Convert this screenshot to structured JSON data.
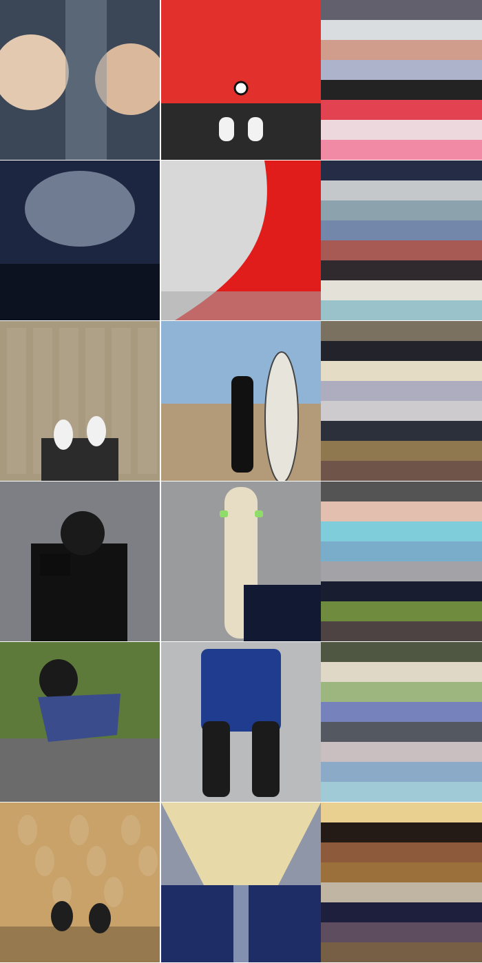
{
  "rows": [
    {
      "photos": [
        {
          "subject": "two-men-selfie-looking-up",
          "palette_hint": [
            "#6d7a86",
            "#e3c9b0"
          ]
        },
        {
          "subject": "red-bmw-hood-and-sneakers",
          "palette_hint": [
            "#e2302c",
            "#2a2a2a"
          ]
        }
      ],
      "swatches": [
        "#62606c",
        "#d9dde0",
        "#d09c8b",
        "#acb3cb",
        "#232323",
        "#e34350",
        "#ecd8dd",
        "#f08aa5"
      ]
    },
    {
      "photos": [
        {
          "subject": "concert-crowd-stage-lights",
          "palette_hint": [
            "#1c2640",
            "#b7c3d4"
          ]
        },
        {
          "subject": "gallery-red-curved-wall",
          "palette_hint": [
            "#e11d1b",
            "#d8d8d8"
          ]
        }
      ],
      "swatches": [
        "#252d46",
        "#c4c8cb",
        "#8ca3ae",
        "#7387ab",
        "#a75a54",
        "#302a2e",
        "#e4e2d8",
        "#9ac2cb"
      ]
    },
    {
      "photos": [
        {
          "subject": "feet-on-patterned-floor",
          "palette_hint": [
            "#a89a7e",
            "#2b2b2b"
          ]
        },
        {
          "subject": "surfer-holding-board-on-beach",
          "palette_hint": [
            "#8fb4d6",
            "#b39a78"
          ]
        }
      ],
      "swatches": [
        "#7b7160",
        "#23232c",
        "#e4dcc4",
        "#aeadc0",
        "#cdcbce",
        "#2b303b",
        "#8f7750",
        "#6e5449"
      ]
    },
    {
      "photos": [
        {
          "subject": "photographer-with-camera-portrait",
          "palette_hint": [
            "#7d7f85",
            "#111111"
          ]
        },
        {
          "subject": "longboard-on-asphalt-top-down",
          "palette_hint": [
            "#9a9b9d",
            "#e7dcc4"
          ]
        }
      ],
      "swatches": [
        "#545454",
        "#e3bfaf",
        "#7fccda",
        "#79adca",
        "#a3a2a6",
        "#191d30",
        "#6f8b3e",
        "#4e4343"
      ]
    },
    {
      "photos": [
        {
          "subject": "longboarder-in-leather-suit",
          "palette_hint": [
            "#5e7a3a",
            "#3a4c8c"
          ]
        },
        {
          "subject": "racer-leather-pants-boots",
          "palette_hint": [
            "#b9bbbd",
            "#1f3c8f"
          ]
        }
      ],
      "swatches": [
        "#4f5743",
        "#dfd8c6",
        "#9db680",
        "#7582bc",
        "#545860",
        "#c9bfc1",
        "#8baac8",
        "#a0cad6"
      ]
    },
    {
      "photos": [
        {
          "subject": "feet-on-sand-with-footprints",
          "palette_hint": [
            "#c9a269",
            "#1e1e1e"
          ]
        },
        {
          "subject": "airplane-cabin-aisle",
          "palette_hint": [
            "#e8d9a8",
            "#1f2d66"
          ]
        }
      ],
      "swatches": [
        "#e9cf90",
        "#241b16",
        "#8d5b3c",
        "#9c703b",
        "#c0b4a3",
        "#1d1f3d",
        "#5e4d5f",
        "#775f45"
      ]
    }
  ]
}
